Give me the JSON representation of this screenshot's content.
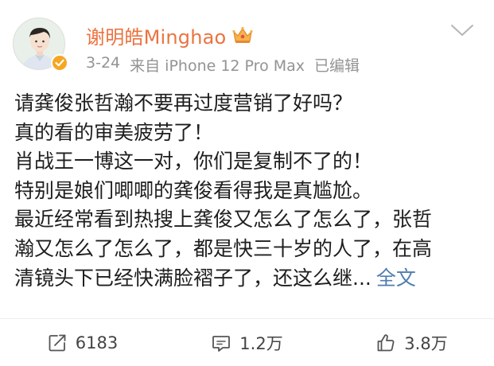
{
  "post": {
    "user_name": "谢明皓Minghao",
    "meta": {
      "date": "3-24",
      "source": "来自 iPhone 12 Pro Max",
      "edited": "已编辑"
    },
    "content_lines": [
      "请龚俊张哲瀚不要再过度营销了好吗？",
      "真的看的审美疲劳了！",
      "肖战王一博这一对，你们是复制不了的！",
      "特别是娘们唧唧的龚俊看得我是真尴尬。",
      "最近经常看到热搜上龚俊又怎么了怎么了，张哲",
      "瀚又怎么了怎么了，都是快三十岁的人了，在高",
      "清镜头下已经快满脸褶子了，还这么继..."
    ],
    "full_text_link": "全文",
    "actions": {
      "repost_count": "6183",
      "comment_count": "1.2万",
      "like_count": "3.8万"
    }
  },
  "colors": {
    "username": "#eb7340",
    "link": "#507daf",
    "meta": "#939393",
    "badge": "#f5a623"
  },
  "icons": [
    "verified-badge-icon",
    "crown-icon",
    "chevron-down-icon",
    "repost-icon",
    "comment-icon",
    "like-icon"
  ]
}
